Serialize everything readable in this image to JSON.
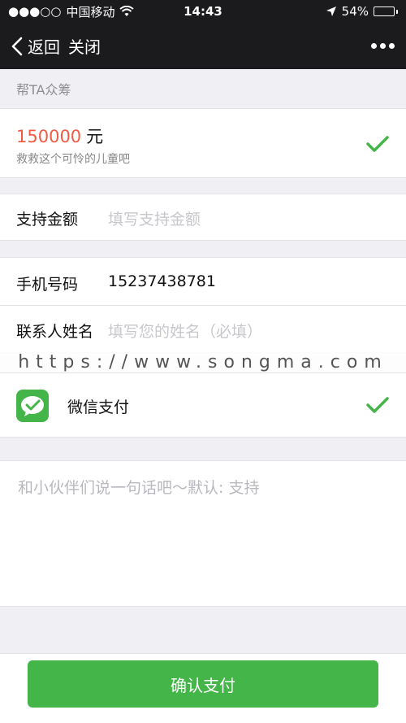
{
  "status_bar": {
    "signal": "●●●○○",
    "carrier": "中国移动",
    "wifi_icon": "wifi-icon",
    "time": "14:43",
    "location_icon": "location-arrow-icon",
    "battery_percent": "54%",
    "battery_level": 0.54
  },
  "nav": {
    "back_label": "返回",
    "close_label": "关闭",
    "more_icon": "more-dots-icon"
  },
  "section": {
    "title": "帮TA众筹"
  },
  "target": {
    "amount": "150000",
    "unit": "元",
    "note": "救救这个可怜的儿童吧"
  },
  "support": {
    "label": "支持金额",
    "placeholder": "填写支持金额"
  },
  "contact": {
    "phone_label": "手机号码",
    "phone_value": "15237438781",
    "name_label": "联系人姓名",
    "name_placeholder": "填写您的姓名（必填）"
  },
  "watermark": "https://www.songma.com",
  "payment": {
    "method_label": "微信支付"
  },
  "message": {
    "placeholder": "和小伙伴们说一句话吧～默认: 支持"
  },
  "actions": {
    "confirm_label": "确认支付"
  },
  "colors": {
    "accent_green": "#44b549",
    "amount_red": "#ef5b45",
    "nav_bg": "#1b1b1d"
  }
}
